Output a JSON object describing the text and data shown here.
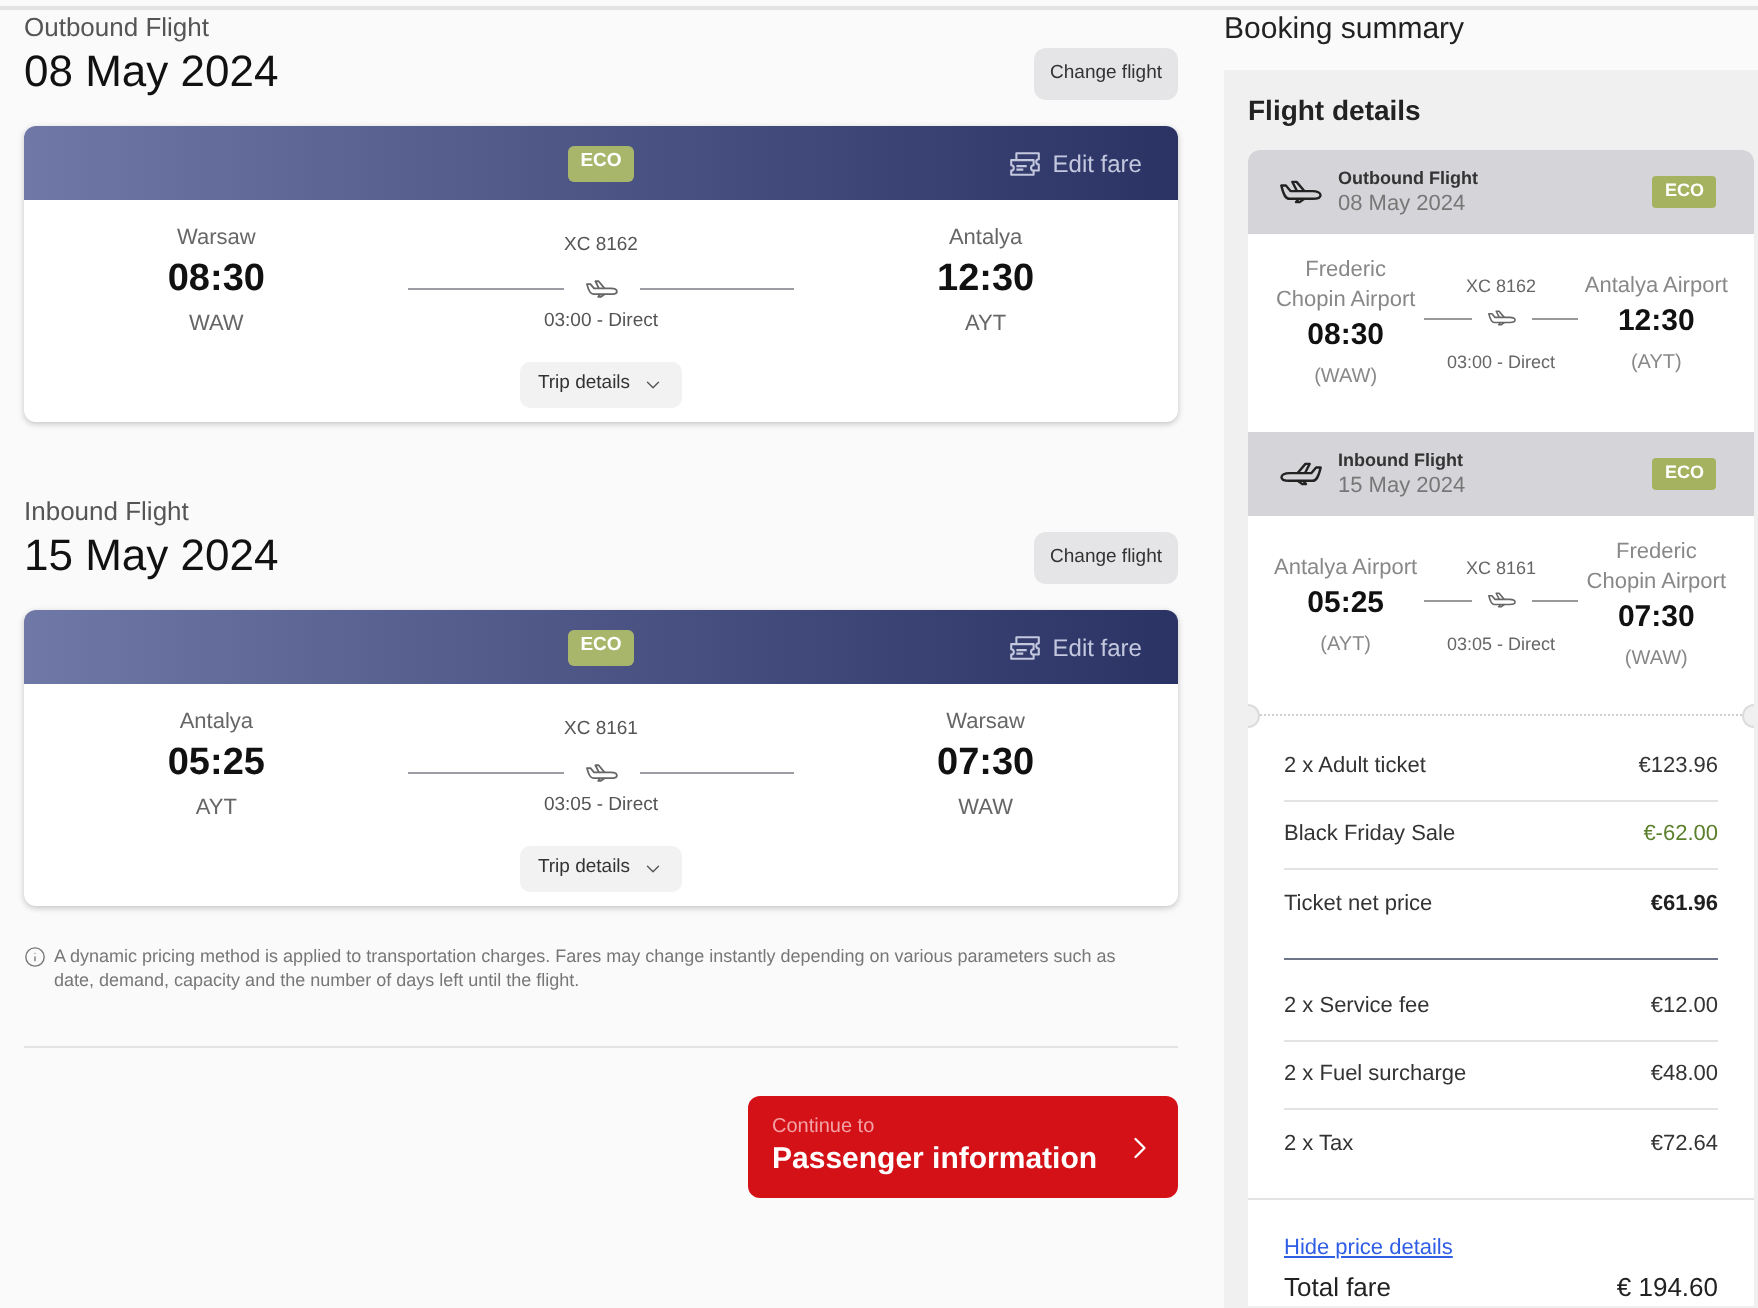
{
  "flights": [
    {
      "label": "Outbound Flight",
      "date": "08 May 2024",
      "change_button": "Change flight",
      "fare_badge": "ECO",
      "edit_fare": "Edit fare",
      "departure": {
        "city": "Warsaw",
        "time": "08:30",
        "code": "WAW"
      },
      "flight_number": "XC 8162",
      "duration": "03:00 - Direct",
      "arrival": {
        "city": "Antalya",
        "time": "12:30",
        "code": "AYT"
      },
      "trip_details": "Trip details"
    },
    {
      "label": "Inbound Flight",
      "date": "15 May 2024",
      "change_button": "Change flight",
      "fare_badge": "ECO",
      "edit_fare": "Edit fare",
      "departure": {
        "city": "Antalya",
        "time": "05:25",
        "code": "AYT"
      },
      "flight_number": "XC 8161",
      "duration": "03:05 - Direct",
      "arrival": {
        "city": "Warsaw",
        "time": "07:30",
        "code": "WAW"
      },
      "trip_details": "Trip details"
    }
  ],
  "pricing_note": "A dynamic pricing method is applied to transportation charges. Fares may change instantly depending on various parameters such as date, demand, capacity and the number of days left until the flight.",
  "continue_button": {
    "caption": "Continue to",
    "label": "Passenger information"
  },
  "summary": {
    "title": "Booking summary",
    "section_title": "Flight details",
    "flights": [
      {
        "kind": "outbound",
        "label": "Outbound Flight",
        "date": "08 May 2024",
        "fare_badge": "ECO",
        "departure": {
          "airport": "Frederic Chopin Airport",
          "time": "08:30",
          "code": "(WAW)"
        },
        "flight_number": "XC 8162",
        "duration": "03:00 - Direct",
        "arrival": {
          "airport": "Antalya Airport",
          "time": "12:30",
          "code": "(AYT)"
        }
      },
      {
        "kind": "inbound",
        "label": "Inbound Flight",
        "date": "15 May 2024",
        "fare_badge": "ECO",
        "departure": {
          "airport": "Antalya Airport",
          "time": "05:25",
          "code": "(AYT)"
        },
        "flight_number": "XC 8161",
        "duration": "03:05 - Direct",
        "arrival": {
          "airport": "Frederic Chopin Airport",
          "time": "07:30",
          "code": "(WAW)"
        }
      }
    ],
    "price_groups": [
      {
        "rows": [
          {
            "kind": "item",
            "label": "2 x Adult ticket",
            "amount": "€123.96"
          },
          {
            "kind": "discount",
            "label": "Black Friday Sale",
            "amount": "€-62.00"
          },
          {
            "kind": "subtotal",
            "label": "Ticket net price",
            "amount": "€61.96"
          }
        ]
      },
      {
        "rows": [
          {
            "kind": "item",
            "label": "2 x Service fee",
            "amount": "€12.00"
          },
          {
            "kind": "item",
            "label": "2 x Fuel surcharge",
            "amount": "€48.00"
          },
          {
            "kind": "item",
            "label": "2 x Tax",
            "amount": "€72.64"
          }
        ]
      }
    ],
    "toggle_link": "Hide price details",
    "total": {
      "label": "Total fare",
      "amount": "€ 194.60"
    }
  }
}
